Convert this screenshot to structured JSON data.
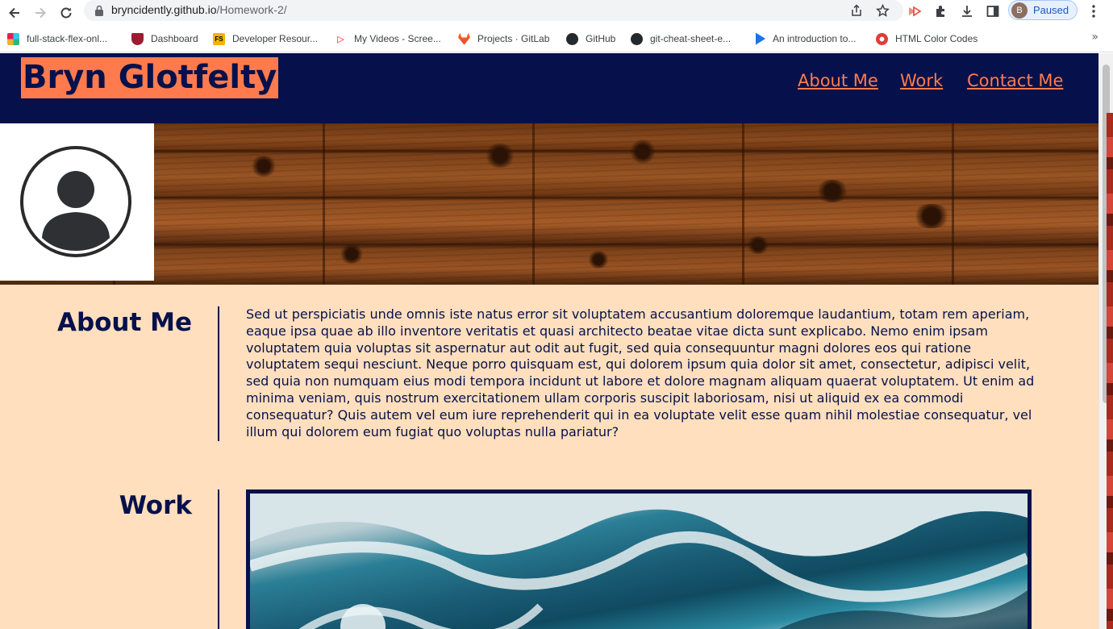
{
  "browser": {
    "url_host": "bryncidently.github.io",
    "url_path": "/Homework-2/",
    "profile_initial": "B",
    "profile_status": "Paused",
    "bookmarks": [
      {
        "label": "full-stack-flex-onl...",
        "icon": "slack-icon",
        "color": "#e01e5a"
      },
      {
        "label": "Dashboard",
        "icon": "shield-icon",
        "color": "#9b1c31"
      },
      {
        "label": "Developer Resour...",
        "icon": "fs-icon",
        "color": "#f4b400"
      },
      {
        "label": "My Videos - Scree...",
        "icon": "video-icon",
        "color": "#ff6b6b"
      },
      {
        "label": "Projects · GitLab",
        "icon": "gitlab-icon",
        "color": "#fc6d26"
      },
      {
        "label": "GitHub",
        "icon": "github-icon",
        "color": "#24292e"
      },
      {
        "label": "git-cheat-sheet-e...",
        "icon": "github-icon",
        "color": "#24292e"
      },
      {
        "label": "An introduction to...",
        "icon": "play-icon",
        "color": "#1a73e8"
      },
      {
        "label": "HTML Color Codes",
        "icon": "color-icon",
        "color": "#e53935"
      }
    ],
    "bookmarks_more": "»"
  },
  "site": {
    "brand": "Bryn Glotfelty",
    "nav": [
      "About Me",
      "Work",
      "Contact Me"
    ],
    "about": {
      "title": "About Me",
      "text": "Sed ut perspiciatis unde omnis iste natus error sit voluptatem accusantium doloremque laudantium, totam rem aperiam, eaque ipsa quae ab illo inventore veritatis et quasi architecto beatae vitae dicta sunt explicabo. Nemo enim ipsam voluptatem quia voluptas sit aspernatur aut odit aut fugit, sed quia consequuntur magni dolores eos qui ratione voluptatem sequi nesciunt. Neque porro quisquam est, qui dolorem ipsum quia dolor sit amet, consectetur, adipisci velit, sed quia non numquam eius modi tempora incidunt ut labore et dolore magnam aliquam quaerat voluptatem. Ut enim ad minima veniam, quis nostrum exercitationem ullam corporis suscipit laboriosam, nisi ut aliquid ex ea commodi consequatur? Quis autem vel eum iure reprehenderit qui in ea voluptate velit esse quam nihil molestiae consequatur, vel illum qui dolorem eum fugiat quo voluptas nulla pariatur?"
    },
    "work": {
      "title": "Work"
    }
  },
  "colors": {
    "navy": "#06114b",
    "coral": "#ff7b4d",
    "peach": "#ffdfbd"
  }
}
